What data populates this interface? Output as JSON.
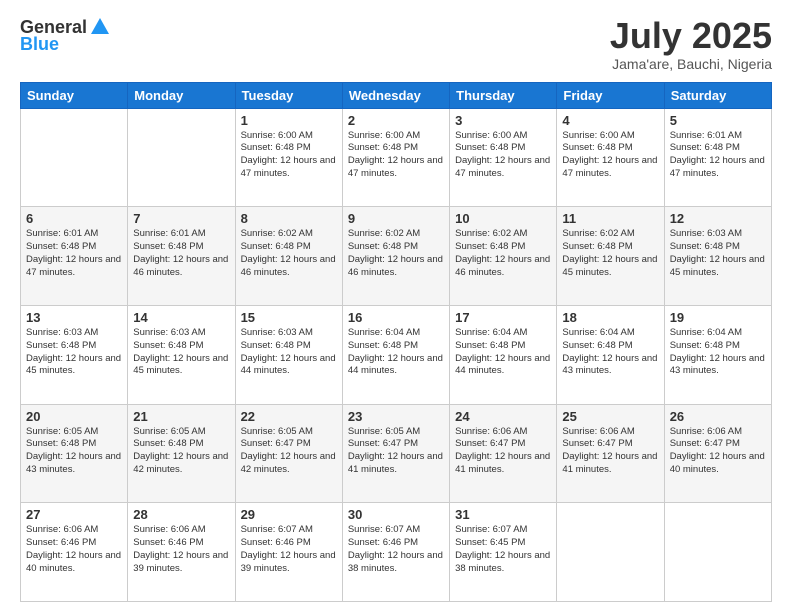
{
  "header": {
    "logo_general": "General",
    "logo_blue": "Blue",
    "title": "July 2025",
    "subtitle": "Jama'are, Bauchi, Nigeria"
  },
  "days_of_week": [
    "Sunday",
    "Monday",
    "Tuesday",
    "Wednesday",
    "Thursday",
    "Friday",
    "Saturday"
  ],
  "weeks": [
    [
      {
        "day": "",
        "sunrise": "",
        "sunset": "",
        "daylight": ""
      },
      {
        "day": "",
        "sunrise": "",
        "sunset": "",
        "daylight": ""
      },
      {
        "day": "1",
        "sunrise": "Sunrise: 6:00 AM",
        "sunset": "Sunset: 6:48 PM",
        "daylight": "Daylight: 12 hours and 47 minutes."
      },
      {
        "day": "2",
        "sunrise": "Sunrise: 6:00 AM",
        "sunset": "Sunset: 6:48 PM",
        "daylight": "Daylight: 12 hours and 47 minutes."
      },
      {
        "day": "3",
        "sunrise": "Sunrise: 6:00 AM",
        "sunset": "Sunset: 6:48 PM",
        "daylight": "Daylight: 12 hours and 47 minutes."
      },
      {
        "day": "4",
        "sunrise": "Sunrise: 6:00 AM",
        "sunset": "Sunset: 6:48 PM",
        "daylight": "Daylight: 12 hours and 47 minutes."
      },
      {
        "day": "5",
        "sunrise": "Sunrise: 6:01 AM",
        "sunset": "Sunset: 6:48 PM",
        "daylight": "Daylight: 12 hours and 47 minutes."
      }
    ],
    [
      {
        "day": "6",
        "sunrise": "Sunrise: 6:01 AM",
        "sunset": "Sunset: 6:48 PM",
        "daylight": "Daylight: 12 hours and 47 minutes."
      },
      {
        "day": "7",
        "sunrise": "Sunrise: 6:01 AM",
        "sunset": "Sunset: 6:48 PM",
        "daylight": "Daylight: 12 hours and 46 minutes."
      },
      {
        "day": "8",
        "sunrise": "Sunrise: 6:02 AM",
        "sunset": "Sunset: 6:48 PM",
        "daylight": "Daylight: 12 hours and 46 minutes."
      },
      {
        "day": "9",
        "sunrise": "Sunrise: 6:02 AM",
        "sunset": "Sunset: 6:48 PM",
        "daylight": "Daylight: 12 hours and 46 minutes."
      },
      {
        "day": "10",
        "sunrise": "Sunrise: 6:02 AM",
        "sunset": "Sunset: 6:48 PM",
        "daylight": "Daylight: 12 hours and 46 minutes."
      },
      {
        "day": "11",
        "sunrise": "Sunrise: 6:02 AM",
        "sunset": "Sunset: 6:48 PM",
        "daylight": "Daylight: 12 hours and 45 minutes."
      },
      {
        "day": "12",
        "sunrise": "Sunrise: 6:03 AM",
        "sunset": "Sunset: 6:48 PM",
        "daylight": "Daylight: 12 hours and 45 minutes."
      }
    ],
    [
      {
        "day": "13",
        "sunrise": "Sunrise: 6:03 AM",
        "sunset": "Sunset: 6:48 PM",
        "daylight": "Daylight: 12 hours and 45 minutes."
      },
      {
        "day": "14",
        "sunrise": "Sunrise: 6:03 AM",
        "sunset": "Sunset: 6:48 PM",
        "daylight": "Daylight: 12 hours and 45 minutes."
      },
      {
        "day": "15",
        "sunrise": "Sunrise: 6:03 AM",
        "sunset": "Sunset: 6:48 PM",
        "daylight": "Daylight: 12 hours and 44 minutes."
      },
      {
        "day": "16",
        "sunrise": "Sunrise: 6:04 AM",
        "sunset": "Sunset: 6:48 PM",
        "daylight": "Daylight: 12 hours and 44 minutes."
      },
      {
        "day": "17",
        "sunrise": "Sunrise: 6:04 AM",
        "sunset": "Sunset: 6:48 PM",
        "daylight": "Daylight: 12 hours and 44 minutes."
      },
      {
        "day": "18",
        "sunrise": "Sunrise: 6:04 AM",
        "sunset": "Sunset: 6:48 PM",
        "daylight": "Daylight: 12 hours and 43 minutes."
      },
      {
        "day": "19",
        "sunrise": "Sunrise: 6:04 AM",
        "sunset": "Sunset: 6:48 PM",
        "daylight": "Daylight: 12 hours and 43 minutes."
      }
    ],
    [
      {
        "day": "20",
        "sunrise": "Sunrise: 6:05 AM",
        "sunset": "Sunset: 6:48 PM",
        "daylight": "Daylight: 12 hours and 43 minutes."
      },
      {
        "day": "21",
        "sunrise": "Sunrise: 6:05 AM",
        "sunset": "Sunset: 6:48 PM",
        "daylight": "Daylight: 12 hours and 42 minutes."
      },
      {
        "day": "22",
        "sunrise": "Sunrise: 6:05 AM",
        "sunset": "Sunset: 6:47 PM",
        "daylight": "Daylight: 12 hours and 42 minutes."
      },
      {
        "day": "23",
        "sunrise": "Sunrise: 6:05 AM",
        "sunset": "Sunset: 6:47 PM",
        "daylight": "Daylight: 12 hours and 41 minutes."
      },
      {
        "day": "24",
        "sunrise": "Sunrise: 6:06 AM",
        "sunset": "Sunset: 6:47 PM",
        "daylight": "Daylight: 12 hours and 41 minutes."
      },
      {
        "day": "25",
        "sunrise": "Sunrise: 6:06 AM",
        "sunset": "Sunset: 6:47 PM",
        "daylight": "Daylight: 12 hours and 41 minutes."
      },
      {
        "day": "26",
        "sunrise": "Sunrise: 6:06 AM",
        "sunset": "Sunset: 6:47 PM",
        "daylight": "Daylight: 12 hours and 40 minutes."
      }
    ],
    [
      {
        "day": "27",
        "sunrise": "Sunrise: 6:06 AM",
        "sunset": "Sunset: 6:46 PM",
        "daylight": "Daylight: 12 hours and 40 minutes."
      },
      {
        "day": "28",
        "sunrise": "Sunrise: 6:06 AM",
        "sunset": "Sunset: 6:46 PM",
        "daylight": "Daylight: 12 hours and 39 minutes."
      },
      {
        "day": "29",
        "sunrise": "Sunrise: 6:07 AM",
        "sunset": "Sunset: 6:46 PM",
        "daylight": "Daylight: 12 hours and 39 minutes."
      },
      {
        "day": "30",
        "sunrise": "Sunrise: 6:07 AM",
        "sunset": "Sunset: 6:46 PM",
        "daylight": "Daylight: 12 hours and 38 minutes."
      },
      {
        "day": "31",
        "sunrise": "Sunrise: 6:07 AM",
        "sunset": "Sunset: 6:45 PM",
        "daylight": "Daylight: 12 hours and 38 minutes."
      },
      {
        "day": "",
        "sunrise": "",
        "sunset": "",
        "daylight": ""
      },
      {
        "day": "",
        "sunrise": "",
        "sunset": "",
        "daylight": ""
      }
    ]
  ]
}
